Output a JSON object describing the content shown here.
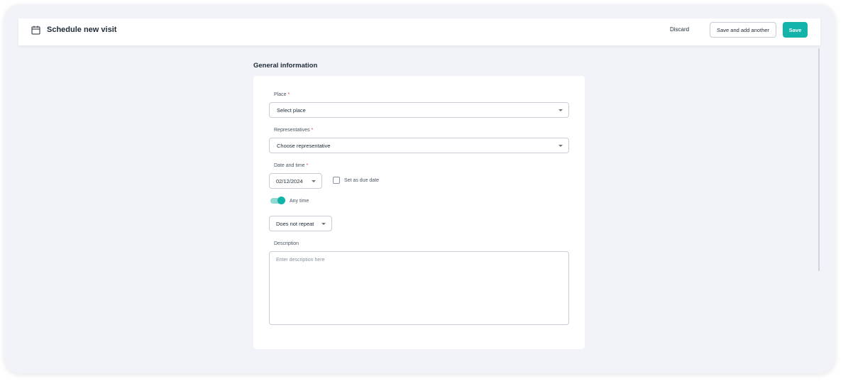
{
  "header": {
    "title": "Schedule new visit",
    "icon": "calendar-icon",
    "discard_label": "Discard",
    "save_and_add_label": "Save and add another",
    "save_label": "Save"
  },
  "section": {
    "title": "General information"
  },
  "form": {
    "place": {
      "label": "Place",
      "required_mark": "*",
      "value": "Select place"
    },
    "representatives": {
      "label": "Representatives",
      "required_mark": "*",
      "value": "Choose representative"
    },
    "date_time": {
      "label": "Date and time",
      "required_mark": "*",
      "date": "02/12/2024"
    },
    "due_date": {
      "label": "Set as due date",
      "checked": false
    },
    "any_time": {
      "label": "Any time",
      "on": true
    },
    "repeat": {
      "value": "Does not repeat"
    },
    "description": {
      "label": "Description",
      "placeholder": "Enter description here"
    }
  },
  "colors": {
    "accent": "#12b3a8",
    "required": "#e5484d",
    "background": "#f2f3f8"
  }
}
